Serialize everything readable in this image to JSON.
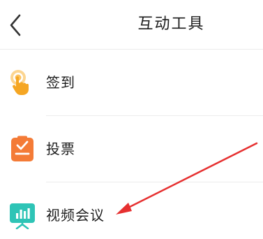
{
  "header": {
    "title": "互动工具"
  },
  "tools": [
    {
      "label": "签到",
      "icon": "hand-tap-icon"
    },
    {
      "label": "投票",
      "icon": "vote-clipboard-icon"
    },
    {
      "label": "视频会议",
      "icon": "presentation-chart-icon"
    }
  ],
  "colors": {
    "sign_in_icon": "#F5A623",
    "vote_icon": "#F47B37",
    "video_meeting_icon": "#2EC4B6",
    "annotation_arrow": "#E63030"
  }
}
